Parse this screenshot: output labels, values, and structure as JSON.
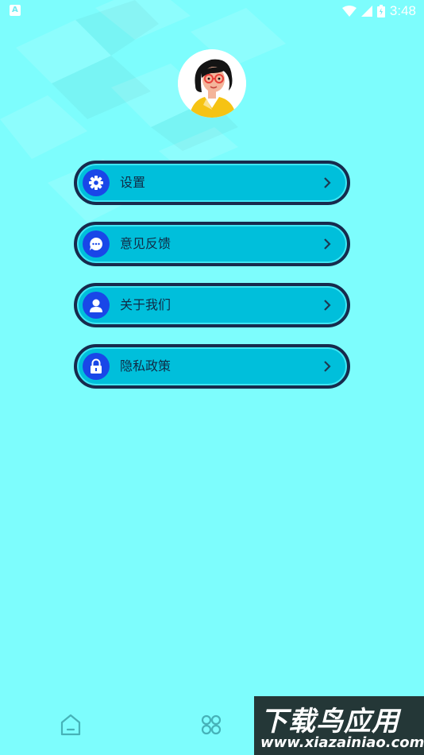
{
  "status_bar": {
    "time": "3:48",
    "left_icon_letter": "A"
  },
  "menu": [
    {
      "label": "设置",
      "icon": "gear-icon"
    },
    {
      "label": "意见反馈",
      "icon": "chat-bubble-icon"
    },
    {
      "label": "关于我们",
      "icon": "person-icon"
    },
    {
      "label": "隐私政策",
      "icon": "lock-icon"
    }
  ],
  "bottom_nav": [
    {
      "icon": "home-icon"
    },
    {
      "icon": "grid-icon"
    }
  ],
  "watermark": {
    "title": "下载鸟应用",
    "url": "www.xiazainiao.com"
  },
  "colors": {
    "background": "#7dfdfd",
    "menu_fill": "#00bfdb",
    "menu_border": "#172a4c",
    "icon_circle": "#1947e8",
    "nav_icon": "#46b2b8"
  }
}
